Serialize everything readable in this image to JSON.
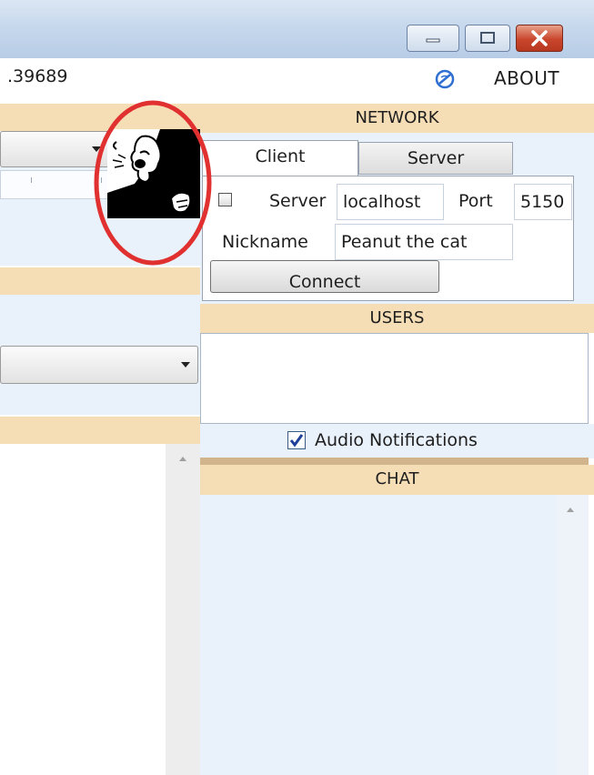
{
  "titlebar": {
    "controls": [
      "minimize-icon",
      "maximize-icon",
      "close-icon"
    ],
    "close_color": "#c9462c"
  },
  "header": {
    "version_text": ".39689",
    "about_label": "ABOUT",
    "about_icon": "globe-icon"
  },
  "network": {
    "title": "NETWORK",
    "tabs": [
      {
        "label": "Client",
        "active": true
      },
      {
        "label": "Server",
        "active": false
      }
    ],
    "server_label": "Server",
    "server_value": "localhost",
    "port_label": "Port",
    "port_value": "5150",
    "nickname_label": "Nickname",
    "nickname_value": "Peanut the cat",
    "server_checked": false,
    "connect_label": "Connect"
  },
  "users": {
    "title": "USERS",
    "audio_label": "Audio Notifications",
    "audio_checked": true
  },
  "chat": {
    "title": "CHAT"
  },
  "annotation": {
    "image": "shouting-man-icon",
    "circle_color": "#e03030"
  },
  "colors": {
    "section_header": "#f5ddb6",
    "panel": "#e9f1fa",
    "titlebar": "#c5d7ec"
  }
}
